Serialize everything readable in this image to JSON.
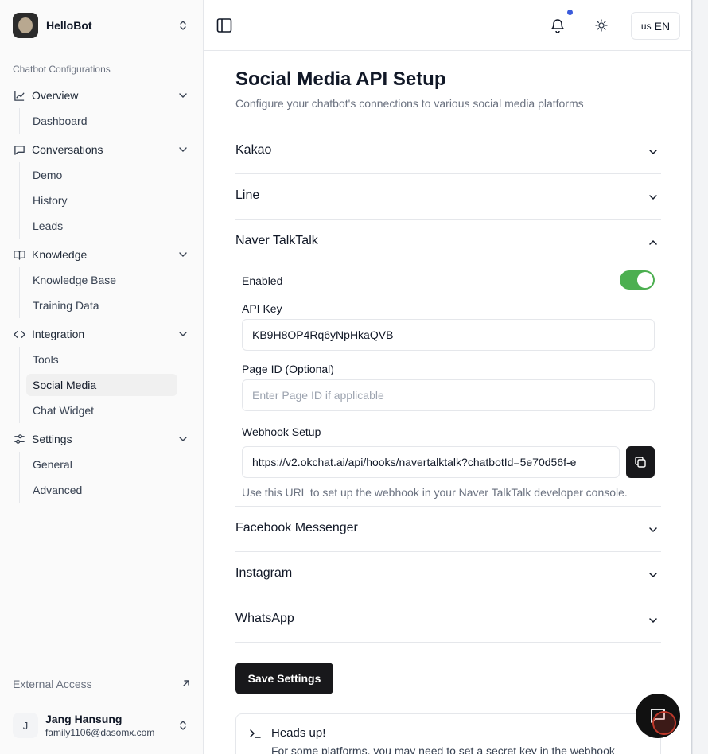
{
  "brand": {
    "name": "HelloBot"
  },
  "sidebar": {
    "section_label": "Chatbot Configurations",
    "groups": [
      {
        "label": "Overview",
        "icon": "chart-icon",
        "items": [
          "Dashboard"
        ]
      },
      {
        "label": "Conversations",
        "icon": "message-icon",
        "items": [
          "Demo",
          "History",
          "Leads"
        ]
      },
      {
        "label": "Knowledge",
        "icon": "book-icon",
        "items": [
          "Knowledge Base",
          "Training Data"
        ]
      },
      {
        "label": "Integration",
        "icon": "code-icon",
        "items": [
          "Tools",
          "Social Media",
          "Chat Widget"
        ]
      },
      {
        "label": "Settings",
        "icon": "sliders-icon",
        "items": [
          "General",
          "Advanced"
        ]
      }
    ],
    "active_item": "Social Media",
    "external_access": "External Access",
    "user": {
      "initial": "J",
      "name": "Jang Hansung",
      "email": "family1106@dasomx.com"
    }
  },
  "topbar": {
    "language": {
      "flag": "us",
      "code": "EN"
    },
    "notification_dot_color": "#3b5bdb"
  },
  "page": {
    "title": "Social Media API Setup",
    "subtitle": "Configure your chatbot's connections to various social media platforms"
  },
  "platforms": {
    "kakao": "Kakao",
    "line": "Line",
    "naver": "Naver TalkTalk",
    "facebook": "Facebook Messenger",
    "instagram": "Instagram",
    "whatsapp": "WhatsApp"
  },
  "naver_form": {
    "enabled_label": "Enabled",
    "enabled": true,
    "api_key_label": "API Key",
    "api_key_value": "KB9H8OP4Rq6yNpHkaQVB",
    "page_id_label": "Page ID (Optional)",
    "page_id_placeholder": "Enter Page ID if applicable",
    "webhook_label": "Webhook Setup",
    "webhook_value": "https://v2.okchat.ai/api/hooks/navertalktalk?chatbotId=5e70d56f-e",
    "webhook_hint": "Use this URL to set up the webhook in your Naver TalkTalk developer console."
  },
  "actions": {
    "save_label": "Save Settings"
  },
  "alert": {
    "title": "Heads up!",
    "text": "For some platforms, you may need to set a secret key in the webhook"
  },
  "colors": {
    "toggle_on": "#4caf50",
    "primary": "#18181b"
  }
}
